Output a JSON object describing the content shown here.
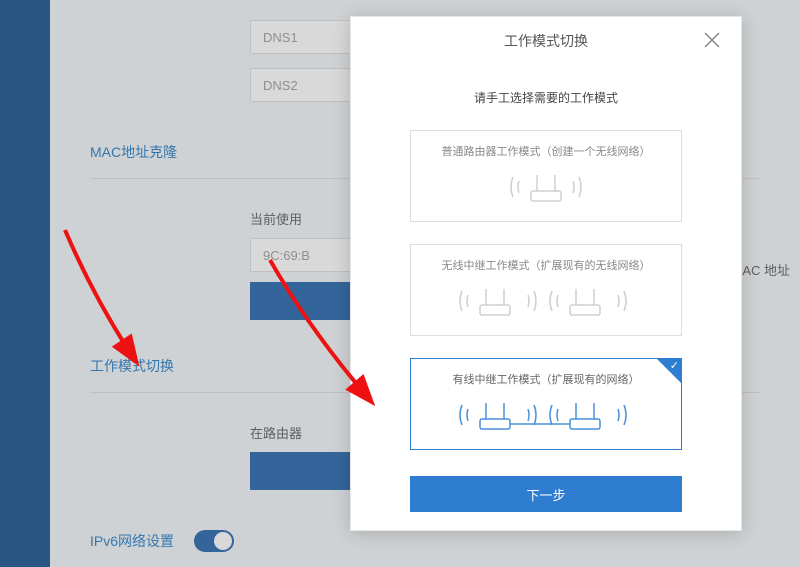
{
  "page": {
    "dns1_label": "DNS1",
    "dns2_label": "DNS2",
    "mac_section_title": "MAC地址克隆",
    "current_use_label": "当前使用",
    "mac_value": "9C:69:B",
    "tail_text": "AC 地址",
    "mode_section_title": "工作模式切换",
    "router_line_label": "在路由器",
    "ipv6_title": "IPv6网络设置"
  },
  "modal": {
    "title": "工作模式切换",
    "subtitle": "请手工选择需要的工作模式",
    "options": [
      {
        "label": "普通路由器工作模式（创建一个无线网络）"
      },
      {
        "label": "无线中继工作模式（扩展现有的无线网络）"
      },
      {
        "label": "有线中继工作模式（扩展现有的网络）"
      }
    ],
    "next_label": "下一步"
  }
}
